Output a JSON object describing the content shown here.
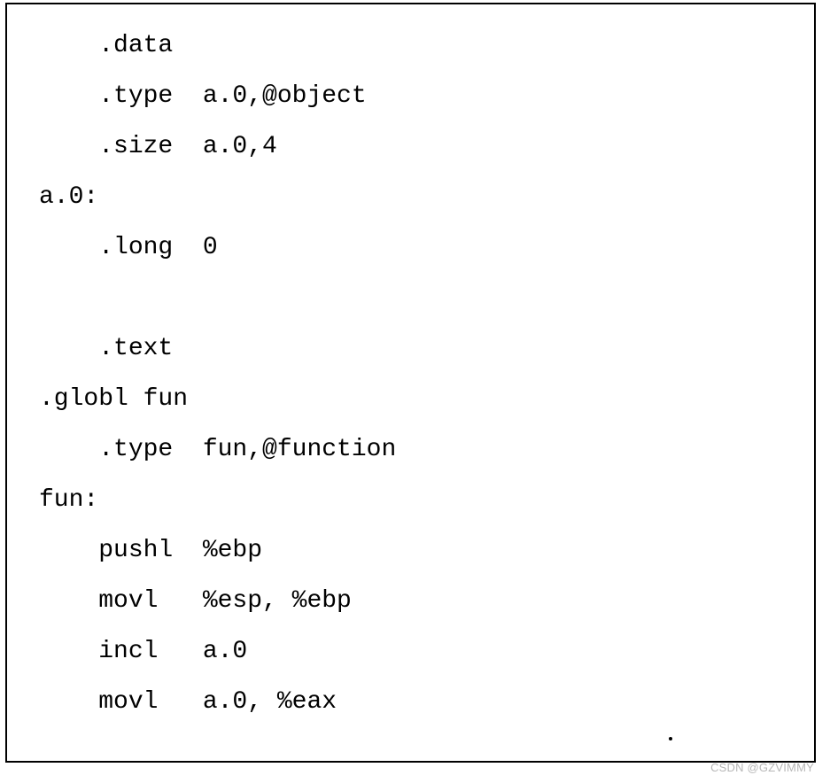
{
  "code": {
    "l1": "    .data",
    "l2": "    .type  a.0,@object",
    "l3": "    .size  a.0,4",
    "l4": "a.0:",
    "l5": "    .long  0",
    "l6": "    .text",
    "l7": ".globl fun",
    "l8": "    .type  fun,@function",
    "l9": "fun:",
    "l10": "    pushl  %ebp",
    "l11": "    movl   %esp, %ebp",
    "l12": "    incl   a.0",
    "l13": "    movl   a.0, %eax"
  },
  "watermark": "CSDN @GZVIMMY"
}
